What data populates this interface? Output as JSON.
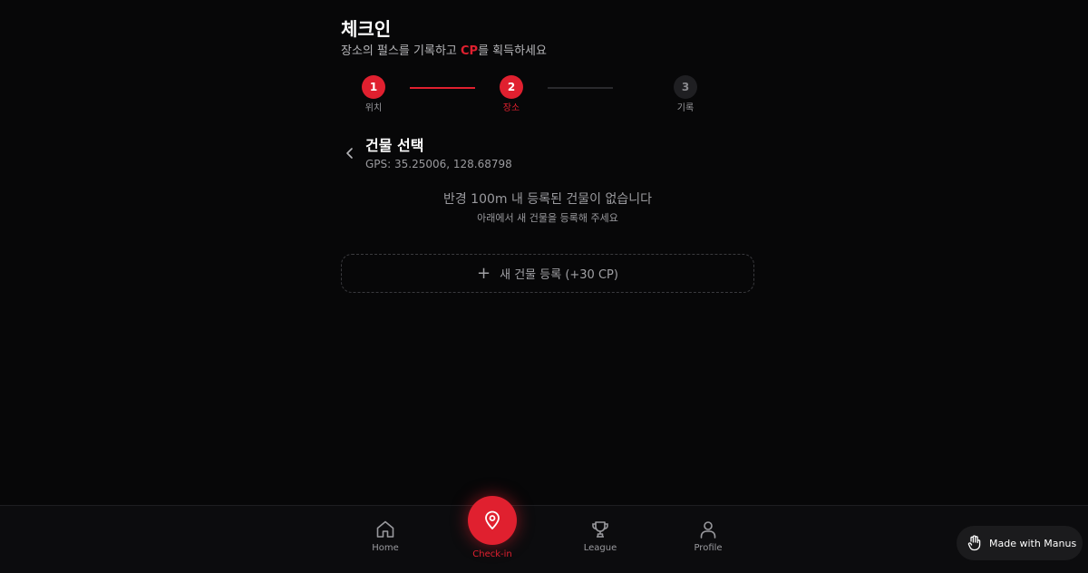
{
  "header": {
    "title": "체크인",
    "subtitle_before": "장소의 펄스를 기록하고 ",
    "subtitle_accent": "CP",
    "subtitle_after": "를 획득하세요"
  },
  "stepper": {
    "steps": [
      {
        "number": "1",
        "label": "위치",
        "state": "done"
      },
      {
        "number": "2",
        "label": "장소",
        "state": "current"
      },
      {
        "number": "3",
        "label": "기록",
        "state": "todo"
      }
    ]
  },
  "section": {
    "title": "건물 선택",
    "gps": "GPS: 35.25006, 128.68798"
  },
  "empty_state": {
    "title": "반경 100m 내 등록된 건물이 없습니다",
    "description": "아래에서 새 건물을 등록해 주세요"
  },
  "register": {
    "label": "새 건물 등록 (+30 CP)"
  },
  "bottom_nav": {
    "items": [
      {
        "label": "Home",
        "icon": "home-icon"
      },
      {
        "label": "Check-in",
        "icon": "map-pin-icon"
      },
      {
        "label": "League",
        "icon": "trophy-icon"
      },
      {
        "label": "Profile",
        "icon": "user-icon"
      }
    ]
  },
  "badge": {
    "label": "Made with Manus",
    "icon": "manus-hand-icon"
  },
  "colors": {
    "accent": "#e0202f",
    "background": "#070708",
    "muted_text": "#9a9a9e"
  }
}
